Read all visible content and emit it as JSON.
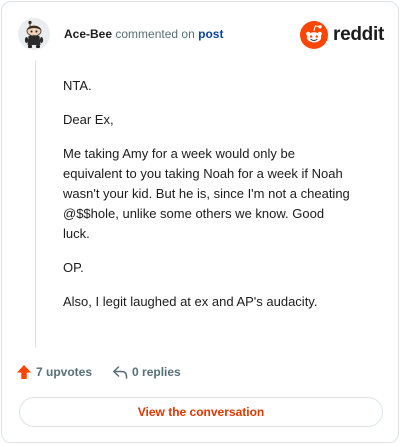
{
  "comment": {
    "author": "Ace-Bee",
    "action_text": "commented on",
    "target_link": "post",
    "paragraphs": [
      "NTA.",
      "Dear Ex,",
      "Me taking Amy for a week would only be equivalent to you taking Noah for a week if Noah wasn't your kid. But he is, since I'm not a cheating @$$hole, unlike some others we know. Good luck.",
      "OP.",
      "Also, I legit laughed at ex and AP's audacity."
    ]
  },
  "brand": {
    "wordmark": "reddit",
    "color": "#ff4500"
  },
  "actions": {
    "upvotes": "7 upvotes",
    "replies": "0 replies"
  },
  "cta": {
    "label": "View the conversation"
  },
  "colors": {
    "accent": "#d93a00",
    "upvote": "#ff4500",
    "link": "#0a449b",
    "muted": "#576f76"
  },
  "icons": {
    "avatar": "snoo-avatar",
    "logo": "reddit-snoo-logo",
    "upvote": "upvote-arrow-icon",
    "reply": "reply-arrow-icon"
  }
}
